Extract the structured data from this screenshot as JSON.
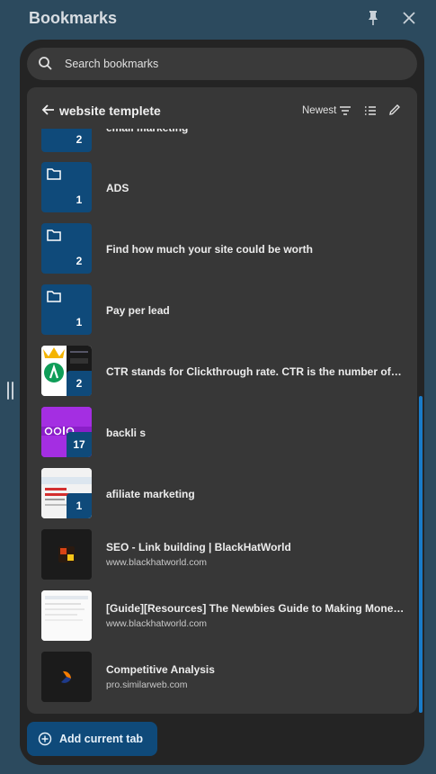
{
  "header": {
    "title": "Bookmarks"
  },
  "search": {
    "placeholder": "Search bookmarks"
  },
  "folder": {
    "name": "website templete",
    "sort_label": "Newest"
  },
  "items": [
    {
      "type": "folder",
      "label": "email marketing",
      "count": "2"
    },
    {
      "type": "folder",
      "label": "ADS",
      "count": "1"
    },
    {
      "type": "folder",
      "label": "Find how much your site could be worth",
      "count": "2"
    },
    {
      "type": "folder",
      "label": "Pay per lead",
      "count": "1"
    },
    {
      "type": "folder",
      "label": "CTR stands for Clickthrough rate. CTR is the number of clic...",
      "count": "2"
    },
    {
      "type": "folder",
      "label": "backli s",
      "count": "17"
    },
    {
      "type": "folder",
      "label": "afiliate marketing",
      "count": "1"
    },
    {
      "type": "link",
      "label": "SEO - Link building | BlackHatWorld",
      "url": "www.blackhatworld.com"
    },
    {
      "type": "link",
      "label": "[Guide][Resources] The Newbies Guide to Making Money S...",
      "url": "www.blackhatworld.com"
    },
    {
      "type": "link",
      "label": "Competitive Analysis",
      "url": "pro.similarweb.com"
    }
  ],
  "footer": {
    "add_label": "Add current tab"
  },
  "colors": {
    "accent": "#0f4a7a",
    "scrollbar": "#1a7cc8",
    "panel": "#242424",
    "card": "#373737"
  }
}
